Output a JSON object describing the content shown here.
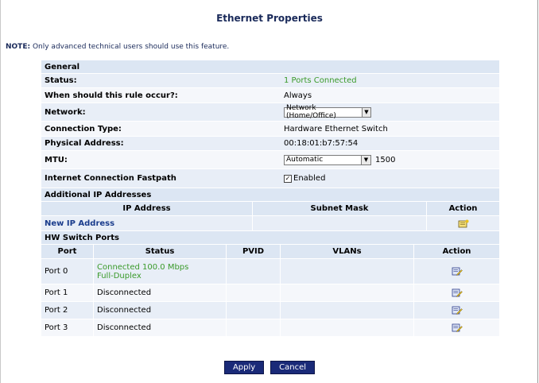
{
  "title": "Ethernet Properties",
  "note": {
    "label": "NOTE:",
    "text": "Only advanced technical users should use this feature."
  },
  "general": {
    "heading": "General",
    "status": {
      "label": "Status:",
      "value": "1 Ports Connected",
      "color": "#3a9a2a"
    },
    "rule": {
      "label": "When should this rule occur?:",
      "value": "Always"
    },
    "network": {
      "label": "Network:",
      "selected": "Network (Home/Office)"
    },
    "connection_type": {
      "label": "Connection Type:",
      "value": "Hardware Ethernet Switch"
    },
    "physical_address": {
      "label": "Physical Address:",
      "value": "00:18:01:b7:57:54"
    },
    "mtu": {
      "label": "MTU:",
      "selected": "Automatic",
      "value": "1500"
    },
    "fastpath": {
      "label": "Internet Connection Fastpath",
      "checked": true,
      "checkbox_label": "Enabled"
    }
  },
  "additional_ip": {
    "heading": "Additional IP Addresses",
    "columns": [
      "IP Address",
      "Subnet Mask",
      "Action"
    ],
    "new_link": "New IP Address"
  },
  "hw_switch": {
    "heading": "HW Switch Ports",
    "columns": [
      "Port",
      "Status",
      "PVID",
      "VLANs",
      "Action"
    ],
    "rows": [
      {
        "port": "Port 0",
        "status_line1": "Connected 100.0 Mbps",
        "status_line2": "Full-Duplex",
        "connected": true
      },
      {
        "port": "Port 1",
        "status_line1": "Disconnected",
        "status_line2": "",
        "connected": false
      },
      {
        "port": "Port 2",
        "status_line1": "Disconnected",
        "status_line2": "",
        "connected": false
      },
      {
        "port": "Port 3",
        "status_line1": "Disconnected",
        "status_line2": "",
        "connected": false
      }
    ]
  },
  "buttons": {
    "apply": "Apply",
    "cancel": "Cancel"
  },
  "colors": {
    "header_bg": "#dce6f3",
    "row_bg": "#e8eef7",
    "button_bg": "#1a2a78",
    "link": "#1a3c8c"
  }
}
